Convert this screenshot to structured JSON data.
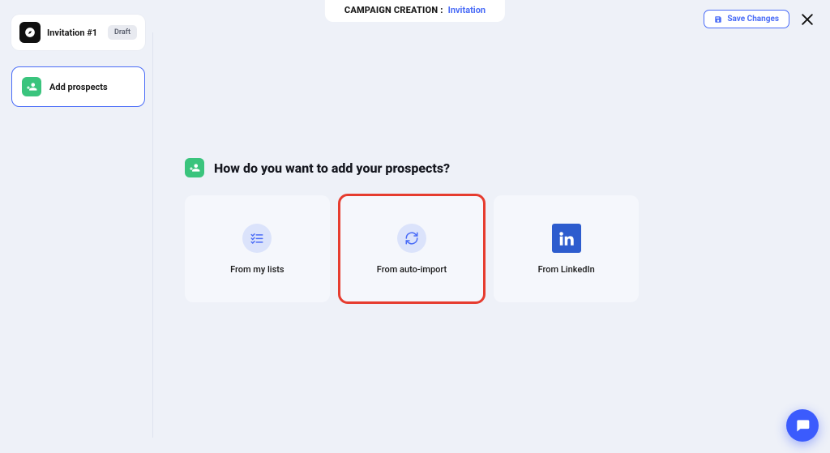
{
  "header": {
    "label": "CAMPAIGN CREATION :",
    "value": "Invitation"
  },
  "actions": {
    "save_label": "Save Changes"
  },
  "sidebar": {
    "campaign": {
      "name": "Invitation #1",
      "status": "Draft"
    },
    "steps": {
      "add_prospects": "Add prospects"
    }
  },
  "main": {
    "question": "How do you want to add your prospects?",
    "options": {
      "from_lists": "From my lists",
      "from_auto_import": "From auto-import",
      "from_linkedin": "From LinkedIn"
    }
  }
}
